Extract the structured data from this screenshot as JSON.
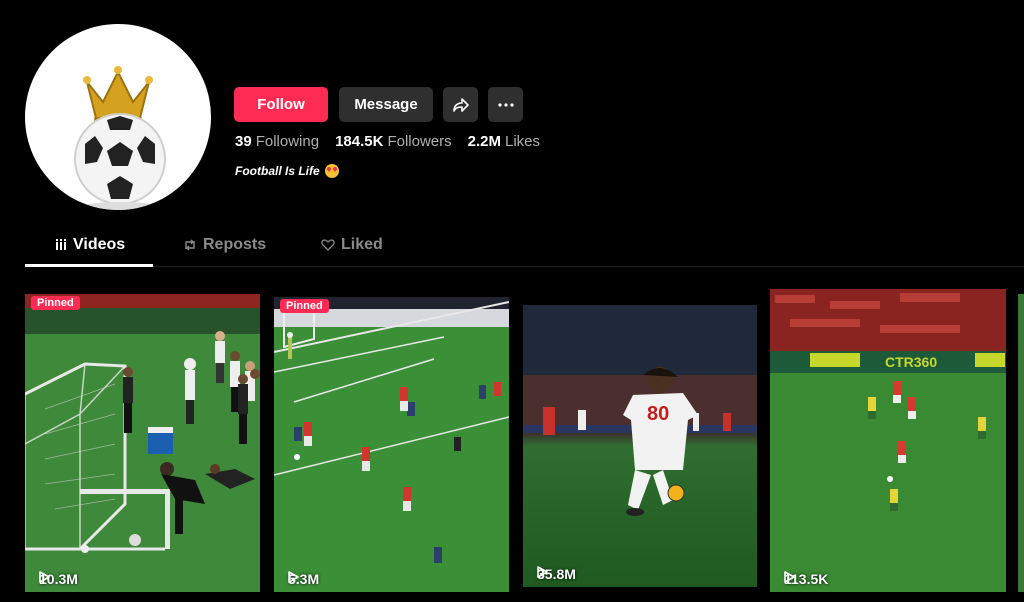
{
  "profile": {
    "follow_label": "Follow",
    "message_label": "Message",
    "share_icon": "share-icon",
    "more_icon": "more-icon",
    "following_count": "39",
    "following_label": "Following",
    "followers_count": "184.5K",
    "followers_label": "Followers",
    "likes_count": "2.2M",
    "likes_label": "Likes",
    "bio": "Football Is Life",
    "bio_emoji": "heart-eyes-emoji"
  },
  "tabs": [
    {
      "label": "Videos",
      "icon": "grid-icon",
      "active": true
    },
    {
      "label": "Reposts",
      "icon": "repost-icon",
      "active": false
    },
    {
      "label": "Liked",
      "icon": "heart-outline-icon",
      "active": false
    }
  ],
  "videos": [
    {
      "views": "10.3M",
      "pinned": true,
      "pinned_label": "Pinned"
    },
    {
      "views": "5.3M",
      "pinned": true,
      "pinned_label": "Pinned"
    },
    {
      "views": "35.8M",
      "pinned": false
    },
    {
      "views": "113.5K",
      "pinned": false
    }
  ],
  "colors": {
    "accent": "#fe2c55",
    "button_bg": "#2f2f2f",
    "background": "#000000"
  }
}
